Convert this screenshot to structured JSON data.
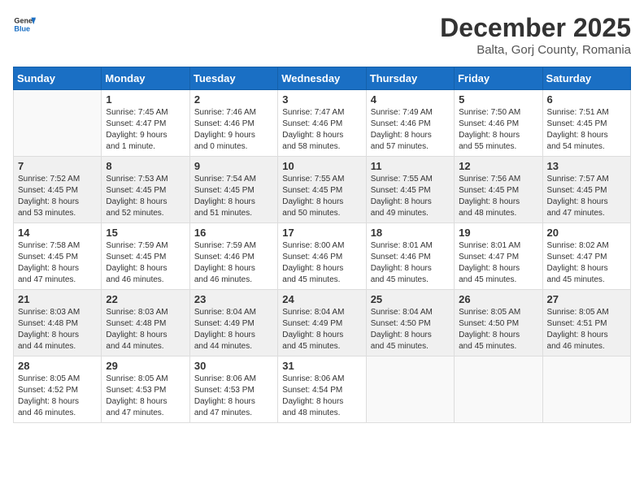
{
  "header": {
    "logo_general": "General",
    "logo_blue": "Blue",
    "month_title": "December 2025",
    "location": "Balta, Gorj County, Romania"
  },
  "columns": [
    "Sunday",
    "Monday",
    "Tuesday",
    "Wednesday",
    "Thursday",
    "Friday",
    "Saturday"
  ],
  "rows": [
    {
      "shaded": false,
      "days": [
        {
          "num": "",
          "info": ""
        },
        {
          "num": "1",
          "info": "Sunrise: 7:45 AM\nSunset: 4:47 PM\nDaylight: 9 hours\nand 1 minute."
        },
        {
          "num": "2",
          "info": "Sunrise: 7:46 AM\nSunset: 4:46 PM\nDaylight: 9 hours\nand 0 minutes."
        },
        {
          "num": "3",
          "info": "Sunrise: 7:47 AM\nSunset: 4:46 PM\nDaylight: 8 hours\nand 58 minutes."
        },
        {
          "num": "4",
          "info": "Sunrise: 7:49 AM\nSunset: 4:46 PM\nDaylight: 8 hours\nand 57 minutes."
        },
        {
          "num": "5",
          "info": "Sunrise: 7:50 AM\nSunset: 4:46 PM\nDaylight: 8 hours\nand 55 minutes."
        },
        {
          "num": "6",
          "info": "Sunrise: 7:51 AM\nSunset: 4:45 PM\nDaylight: 8 hours\nand 54 minutes."
        }
      ]
    },
    {
      "shaded": true,
      "days": [
        {
          "num": "7",
          "info": "Sunrise: 7:52 AM\nSunset: 4:45 PM\nDaylight: 8 hours\nand 53 minutes."
        },
        {
          "num": "8",
          "info": "Sunrise: 7:53 AM\nSunset: 4:45 PM\nDaylight: 8 hours\nand 52 minutes."
        },
        {
          "num": "9",
          "info": "Sunrise: 7:54 AM\nSunset: 4:45 PM\nDaylight: 8 hours\nand 51 minutes."
        },
        {
          "num": "10",
          "info": "Sunrise: 7:55 AM\nSunset: 4:45 PM\nDaylight: 8 hours\nand 50 minutes."
        },
        {
          "num": "11",
          "info": "Sunrise: 7:55 AM\nSunset: 4:45 PM\nDaylight: 8 hours\nand 49 minutes."
        },
        {
          "num": "12",
          "info": "Sunrise: 7:56 AM\nSunset: 4:45 PM\nDaylight: 8 hours\nand 48 minutes."
        },
        {
          "num": "13",
          "info": "Sunrise: 7:57 AM\nSunset: 4:45 PM\nDaylight: 8 hours\nand 47 minutes."
        }
      ]
    },
    {
      "shaded": false,
      "days": [
        {
          "num": "14",
          "info": "Sunrise: 7:58 AM\nSunset: 4:45 PM\nDaylight: 8 hours\nand 47 minutes."
        },
        {
          "num": "15",
          "info": "Sunrise: 7:59 AM\nSunset: 4:45 PM\nDaylight: 8 hours\nand 46 minutes."
        },
        {
          "num": "16",
          "info": "Sunrise: 7:59 AM\nSunset: 4:46 PM\nDaylight: 8 hours\nand 46 minutes."
        },
        {
          "num": "17",
          "info": "Sunrise: 8:00 AM\nSunset: 4:46 PM\nDaylight: 8 hours\nand 45 minutes."
        },
        {
          "num": "18",
          "info": "Sunrise: 8:01 AM\nSunset: 4:46 PM\nDaylight: 8 hours\nand 45 minutes."
        },
        {
          "num": "19",
          "info": "Sunrise: 8:01 AM\nSunset: 4:47 PM\nDaylight: 8 hours\nand 45 minutes."
        },
        {
          "num": "20",
          "info": "Sunrise: 8:02 AM\nSunset: 4:47 PM\nDaylight: 8 hours\nand 45 minutes."
        }
      ]
    },
    {
      "shaded": true,
      "days": [
        {
          "num": "21",
          "info": "Sunrise: 8:03 AM\nSunset: 4:48 PM\nDaylight: 8 hours\nand 44 minutes."
        },
        {
          "num": "22",
          "info": "Sunrise: 8:03 AM\nSunset: 4:48 PM\nDaylight: 8 hours\nand 44 minutes."
        },
        {
          "num": "23",
          "info": "Sunrise: 8:04 AM\nSunset: 4:49 PM\nDaylight: 8 hours\nand 44 minutes."
        },
        {
          "num": "24",
          "info": "Sunrise: 8:04 AM\nSunset: 4:49 PM\nDaylight: 8 hours\nand 45 minutes."
        },
        {
          "num": "25",
          "info": "Sunrise: 8:04 AM\nSunset: 4:50 PM\nDaylight: 8 hours\nand 45 minutes."
        },
        {
          "num": "26",
          "info": "Sunrise: 8:05 AM\nSunset: 4:50 PM\nDaylight: 8 hours\nand 45 minutes."
        },
        {
          "num": "27",
          "info": "Sunrise: 8:05 AM\nSunset: 4:51 PM\nDaylight: 8 hours\nand 46 minutes."
        }
      ]
    },
    {
      "shaded": false,
      "days": [
        {
          "num": "28",
          "info": "Sunrise: 8:05 AM\nSunset: 4:52 PM\nDaylight: 8 hours\nand 46 minutes."
        },
        {
          "num": "29",
          "info": "Sunrise: 8:05 AM\nSunset: 4:53 PM\nDaylight: 8 hours\nand 47 minutes."
        },
        {
          "num": "30",
          "info": "Sunrise: 8:06 AM\nSunset: 4:53 PM\nDaylight: 8 hours\nand 47 minutes."
        },
        {
          "num": "31",
          "info": "Sunrise: 8:06 AM\nSunset: 4:54 PM\nDaylight: 8 hours\nand 48 minutes."
        },
        {
          "num": "",
          "info": ""
        },
        {
          "num": "",
          "info": ""
        },
        {
          "num": "",
          "info": ""
        }
      ]
    }
  ]
}
